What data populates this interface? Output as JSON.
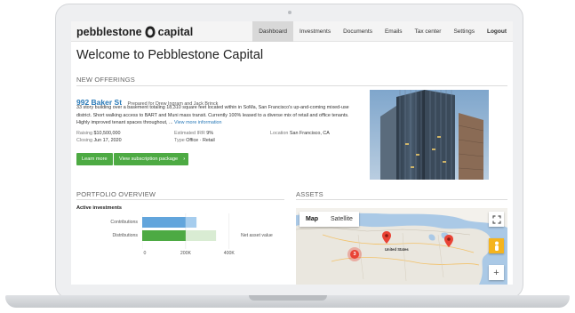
{
  "nav": {
    "logo_left": "pebblestone",
    "logo_right": "capital",
    "items": [
      {
        "label": "Dashboard",
        "active": true
      },
      {
        "label": "Investments"
      },
      {
        "label": "Documents"
      },
      {
        "label": "Emails"
      },
      {
        "label": "Tax center"
      },
      {
        "label": "Settings"
      },
      {
        "label": "Logout",
        "bold": true
      }
    ]
  },
  "page_title": "Welcome to Pebblestone Capital",
  "new_offerings": {
    "heading": "NEW OFFERINGS",
    "property_name": "992 Baker St",
    "prepared_for": "Prepared for Drew Ingram and Jack Brinck",
    "description": "33 story building over a basement totaling 18,310 square feet located within in SoMa, San Francisco's up-and-coming mixed-use district. Short walking access to BART and Muni mass transit. Currently 100% leased to a diverse mix of retail and office tenants. Highly improved tenant spaces throughout, ...",
    "view_more": "View more information",
    "raising_label": "Raising",
    "raising_value": "$10,500,000",
    "closing_label": "Closing",
    "closing_value": "Jun 17, 2020",
    "irr_label": "Estimated IRR",
    "irr_value": "9%",
    "type_label": "Type",
    "type_value": "Office · Retail",
    "location_label": "Location",
    "location_value": "San Francisco, CA",
    "learn_more": "Learn more",
    "view_package": "View subscription package"
  },
  "portfolio": {
    "heading": "PORTFOLIO OVERVIEW",
    "subheading": "Active investments",
    "row_contributions": "Contributions",
    "row_distributions": "Distributions",
    "net_asset_label": "Net asset value",
    "ticks": [
      "0",
      "200K",
      "400K"
    ],
    "axis_max": 450000,
    "contributions": [
      200000,
      50000
    ],
    "distributions": 200000,
    "net_asset_value": 340000,
    "colors": {
      "contrib_main": "#62a5dc",
      "contrib_light": "#a6cdee",
      "dist": "#4daa43",
      "nav": "#d9ecd3"
    }
  },
  "assets": {
    "heading": "ASSETS",
    "map_tab": "Map",
    "satellite_tab": "Satellite",
    "country_label": "United States",
    "cluster_count": "3",
    "zoom_in": "+",
    "fullscreen_icon": "fullscreen-icon",
    "pegman_icon": "pegman-icon"
  }
}
